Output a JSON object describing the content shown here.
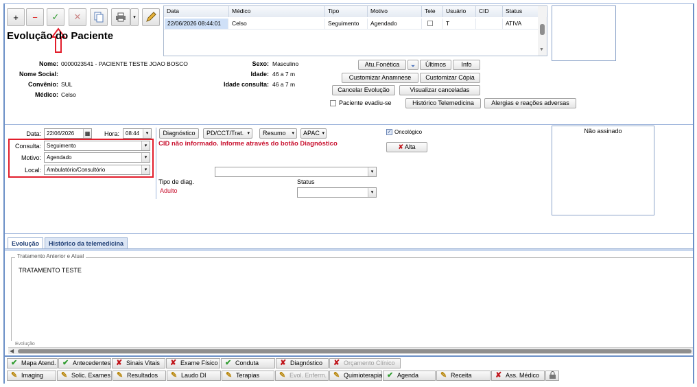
{
  "window_title": "Evolução do Paciente",
  "toolbar": {
    "add": "+",
    "remove": "−",
    "confirm": "✓",
    "cancel": "✕"
  },
  "grid": {
    "columns": [
      "Data",
      "Médico",
      "Tipo",
      "Motivo",
      "Tele",
      "Usuário",
      "CID",
      "Status"
    ],
    "rows": [
      {
        "data": "22/06/2026 08:44:01",
        "medico": "Celso",
        "tipo": "Seguimento",
        "motivo": "Agendado",
        "tele": "",
        "usuario": "T",
        "cid": "",
        "status": "ATIVA"
      }
    ]
  },
  "patient": {
    "nome_label": "Nome:",
    "nome": "0000023541 - PACIENTE TESTE JOAO BOSCO",
    "nome_social_label": "Nome Social:",
    "nome_social": "",
    "convenio_label": "Convênio:",
    "convenio": "SUL",
    "medico_label": "Médico:",
    "medico": "Celso",
    "sexo_label": "Sexo:",
    "sexo": "Masculino",
    "idade_label": "Idade:",
    "idade": "46 a 7 m",
    "idade_consulta_label": "Idade consulta:",
    "idade_consulta": "46 a 7 m"
  },
  "actions": {
    "atu_fonetica": "Atu.Fonética",
    "ultimos": "Últimos",
    "info": "Info",
    "customizar_anamnese": "Customizar Anamnese",
    "customizar_copia": "Customizar Cópia",
    "cancelar_evolucao": "Cancelar Evolução",
    "visualizar_canceladas": "Visualizar canceladas",
    "paciente_evadiu": "Paciente evadiu-se",
    "historico_telemedicina": "Histórico Telemedicina",
    "alergias": "Alergias e reações adversas"
  },
  "form": {
    "data_label": "Data:",
    "data": "22/06/2026",
    "hora_label": "Hora:",
    "hora": "08:44",
    "consulta_label": "Consulta:",
    "consulta": "Seguimento",
    "motivo_label": "Motivo:",
    "motivo": "Agendado",
    "local_label": "Local:",
    "local": "Ambulatório/Consultório",
    "diagnostico": "Diagnóstico",
    "pdt": "PD/CCT/Trat.",
    "resumo": "Resumo",
    "apac": "APAC",
    "cid_warning": "CID não informado. Informe através do botão Diagnóstico",
    "tipo_diag_label": "Tipo de diag.",
    "tipo_diag": "Adulto",
    "status_label": "Status",
    "oncologico": "Oncológico",
    "alta": "Alta",
    "nao_assinado": "Não assinado"
  },
  "tabs": [
    {
      "label": "Evolução",
      "active": true
    },
    {
      "label": "Histórico da telemedicina",
      "active": false
    }
  ],
  "evolution": {
    "legend": "Tratamento Anterior e Atual",
    "text": "TRATAMENTO TESTE",
    "next_legend": "Evolução"
  },
  "bottom_row1": [
    {
      "label": "Mapa Atend.",
      "icon": "check-icon"
    },
    {
      "label": "Antecedentes",
      "icon": "check-icon"
    },
    {
      "label": "Sinais Vitais",
      "icon": "x-icon"
    },
    {
      "label": "Exame Físico",
      "icon": "x-icon"
    },
    {
      "label": "Conduta",
      "icon": "check-icon"
    },
    {
      "label": "Diagnóstico",
      "icon": "x-icon"
    },
    {
      "label": "Orçamento Clínico",
      "icon": "x-icon",
      "disabled": true
    }
  ],
  "bottom_row2": [
    {
      "label": "Imaging",
      "icon": "pencil-icon"
    },
    {
      "label": "Solic. Exames",
      "icon": "pencil-icon"
    },
    {
      "label": "Resultados",
      "icon": "pencil-icon"
    },
    {
      "label": "Laudo DI",
      "icon": "pencil-icon"
    },
    {
      "label": "Terapias",
      "icon": "pencil-icon"
    },
    {
      "label": "Evol. Enferm.",
      "icon": "pencil-icon",
      "disabled": true
    },
    {
      "label": "Quimioterapia",
      "icon": "pencil-icon"
    },
    {
      "label": "Agenda",
      "icon": "check-icon"
    },
    {
      "label": "Receita",
      "icon": "pencil-icon"
    },
    {
      "label": "Ass. Médico",
      "icon": "x-icon"
    }
  ]
}
